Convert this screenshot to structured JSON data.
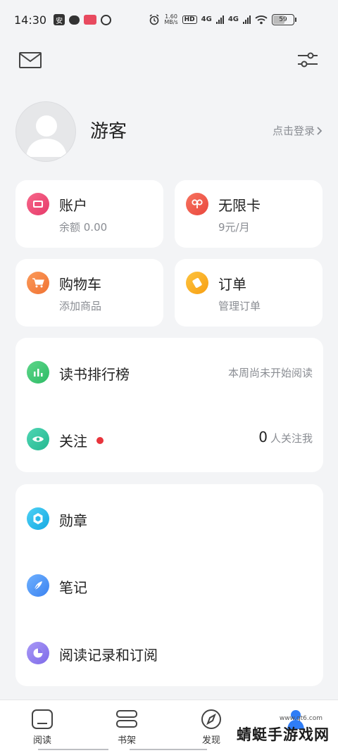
{
  "status_bar": {
    "time": "14:30",
    "net_speed": "1.60",
    "net_unit": "MB/s",
    "hd_label": "HD",
    "net1": "4G",
    "net2": "4G",
    "battery": "59",
    "battery_level_percent": 59,
    "app_icon_char": "安"
  },
  "profile": {
    "username": "游客",
    "login_link": "点击登录"
  },
  "tiles": [
    {
      "title": "账户",
      "sub": "余额 0.00",
      "color": "#f0506e"
    },
    {
      "title": "无限卡",
      "sub": "9元/月",
      "color": "#f25c4f"
    },
    {
      "title": "购物车",
      "sub": "添加商品",
      "color": "#f5843f"
    },
    {
      "title": "订单",
      "sub": "管理订单",
      "color": "#fbb024"
    }
  ],
  "social": {
    "ranking_label": "读书排行榜",
    "ranking_status": "本周尚未开始阅读",
    "follow_label": "关注",
    "follow_count": "0",
    "follow_suffix": "人关注我"
  },
  "more": {
    "badges_label": "勋章",
    "notes_label": "笔记",
    "history_label": "阅读记录和订阅"
  },
  "nav": {
    "items": [
      "阅读",
      "书架",
      "发现"
    ],
    "active_color": "#2f7df6"
  },
  "watermark": {
    "text": "蜻蜓手游戏网",
    "url": "www.qt6.com"
  }
}
